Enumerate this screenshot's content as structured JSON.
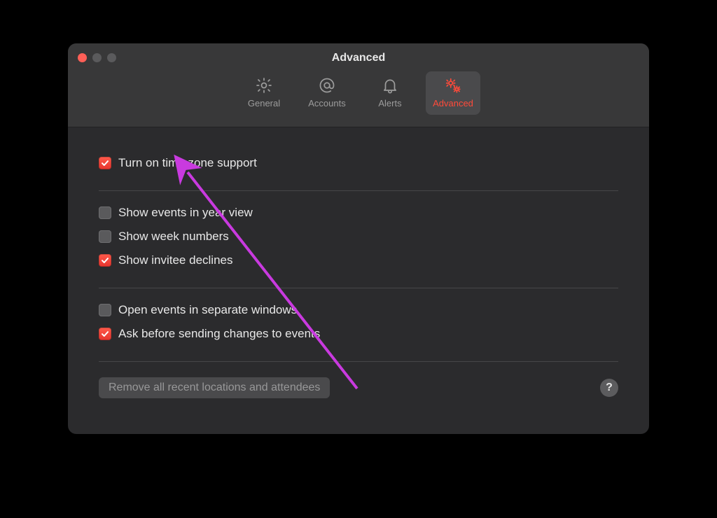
{
  "window": {
    "title": "Advanced"
  },
  "tabs": {
    "general": {
      "label": "General",
      "selected": false
    },
    "accounts": {
      "label": "Accounts",
      "selected": false
    },
    "alerts": {
      "label": "Alerts",
      "selected": false
    },
    "advanced": {
      "label": "Advanced",
      "selected": true
    }
  },
  "options": {
    "timezone": {
      "label": "Turn on time zone support",
      "checked": true
    },
    "year_view": {
      "label": "Show events in year view",
      "checked": false
    },
    "week_numbers": {
      "label": "Show week numbers",
      "checked": false
    },
    "invitee_declines": {
      "label": "Show invitee declines",
      "checked": true
    },
    "separate_windows": {
      "label": "Open events in separate windows",
      "checked": false
    },
    "ask_before_send": {
      "label": "Ask before sending changes to events",
      "checked": true
    }
  },
  "footer": {
    "remove_button": "Remove all recent locations and attendees",
    "help_label": "?"
  },
  "annotation": {
    "color": "#c93adf"
  }
}
